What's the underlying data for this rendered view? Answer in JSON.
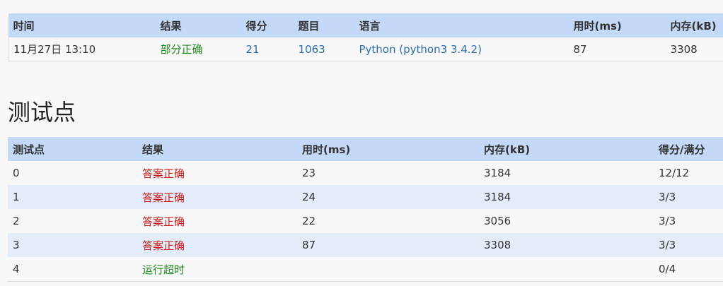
{
  "summary": {
    "headers": [
      "时间",
      "结果",
      "得分",
      "题目",
      "语言",
      "用时(ms)",
      "内存(kB)"
    ],
    "row": {
      "time": "11月27日 13:10",
      "result": "部分正确",
      "score": "21",
      "problem": "1063",
      "language": "Python (python3 3.4.2)",
      "time_ms": "87",
      "memory_kb": "3308"
    }
  },
  "tests": {
    "title": "测试点",
    "headers": [
      "测试点",
      "结果",
      "用时(ms)",
      "内存(kB)",
      "得分/满分"
    ],
    "rows": [
      {
        "id": "0",
        "result": "答案正确",
        "status": "red",
        "time_ms": "23",
        "memory_kb": "3184",
        "score": "12/12"
      },
      {
        "id": "1",
        "result": "答案正确",
        "status": "red",
        "time_ms": "24",
        "memory_kb": "3184",
        "score": "3/3"
      },
      {
        "id": "2",
        "result": "答案正确",
        "status": "red",
        "time_ms": "22",
        "memory_kb": "3056",
        "score": "3/3"
      },
      {
        "id": "3",
        "result": "答案正确",
        "status": "red",
        "time_ms": "87",
        "memory_kb": "3308",
        "score": "3/3"
      },
      {
        "id": "4",
        "result": "运行超时",
        "status": "green",
        "time_ms": "",
        "memory_kb": "",
        "score": "0/4"
      }
    ]
  },
  "colors": {
    "header_bg": "#c4d9f7",
    "row_alt_bg": "#e4ecf9",
    "link": "#2a6db5",
    "status_red": "#cc1a1a",
    "status_green": "#1a8a1a"
  }
}
